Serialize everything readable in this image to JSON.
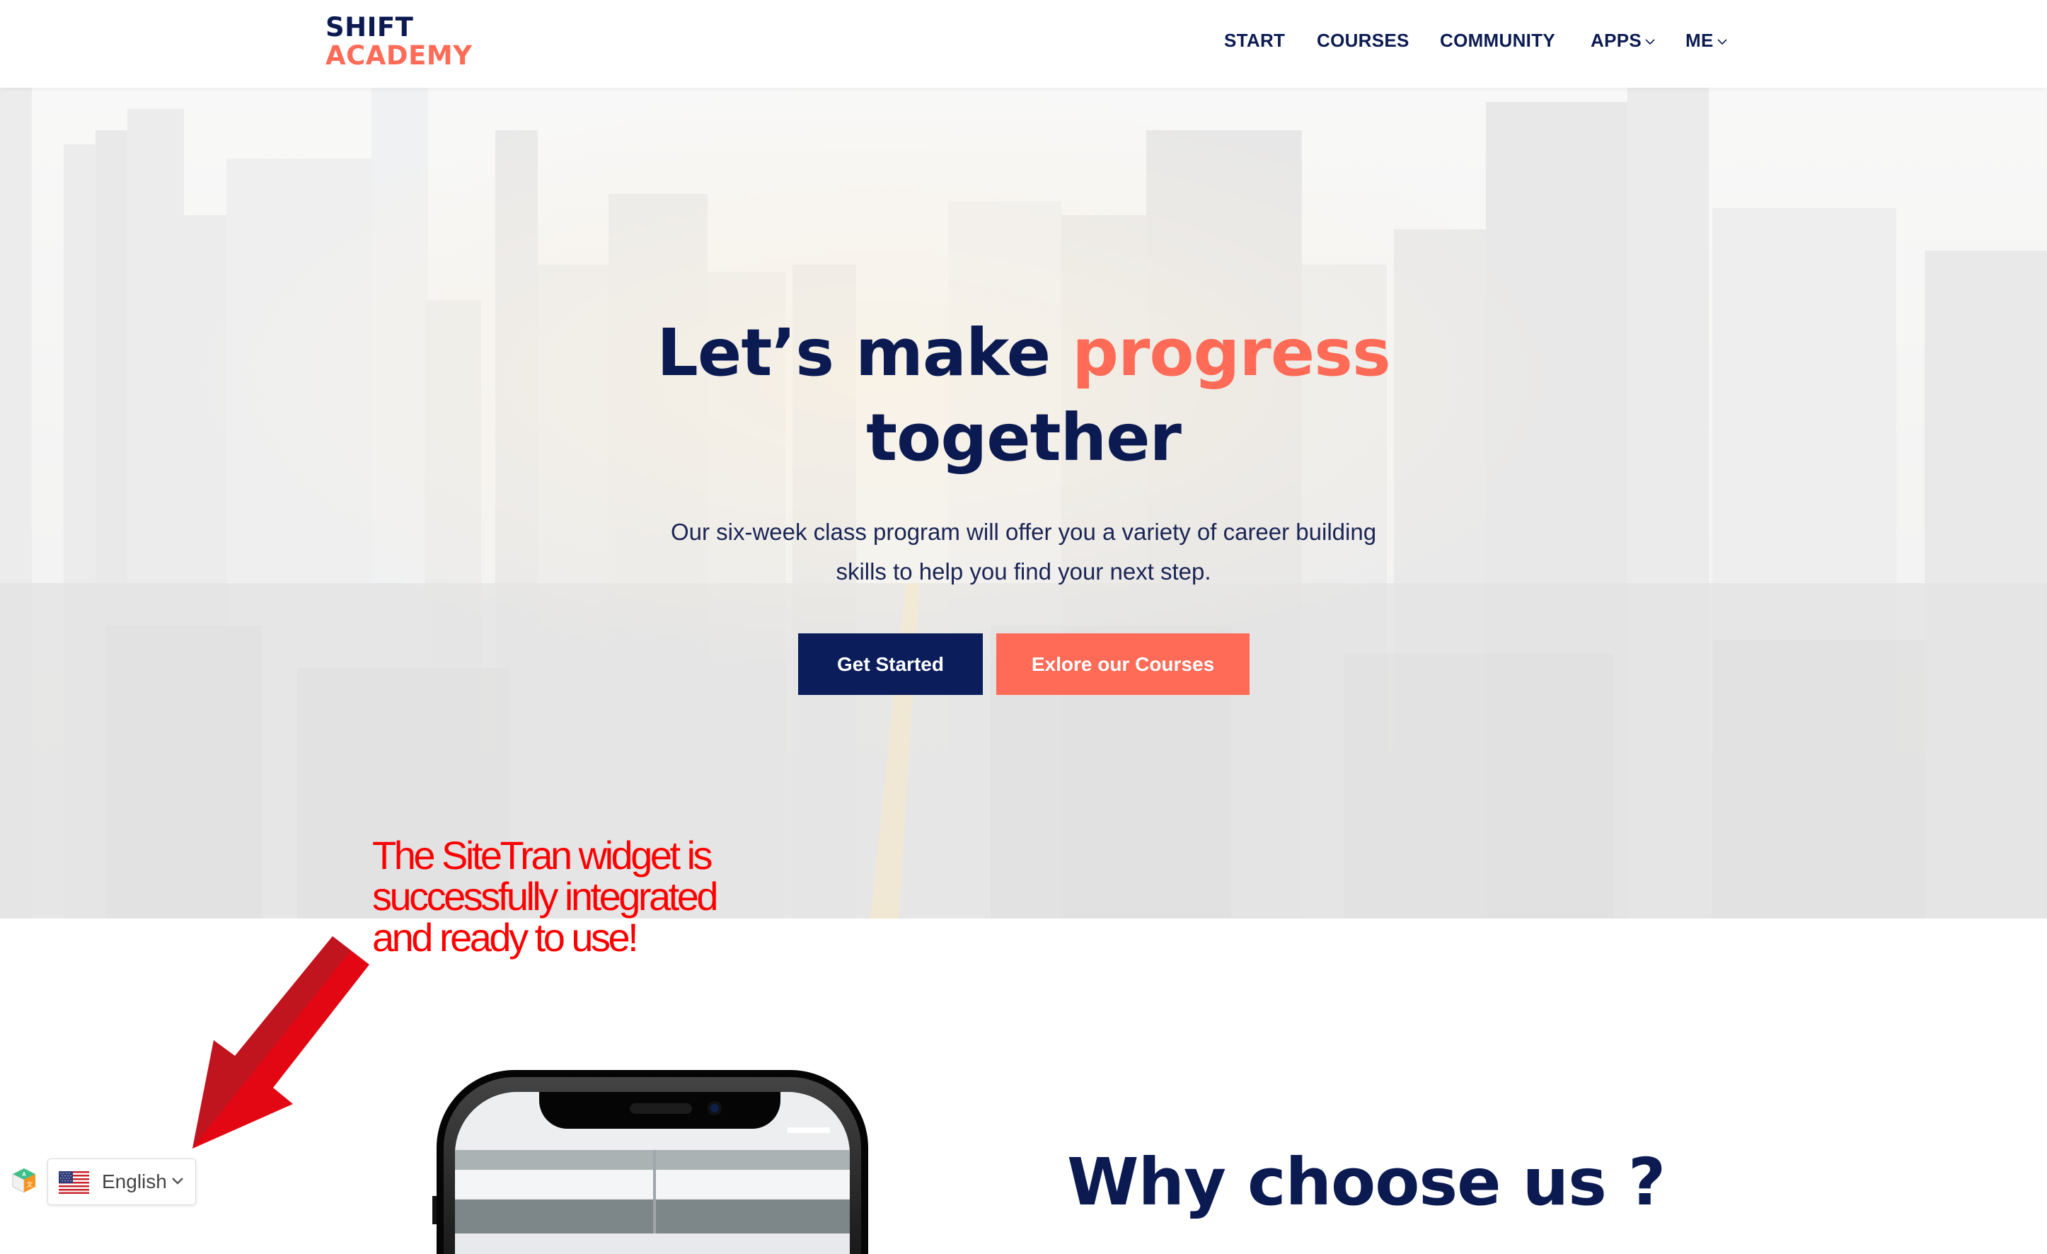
{
  "header": {
    "logo_line1": "SHIFT",
    "logo_line2": "ACADEMY",
    "nav": [
      {
        "label": "START",
        "has_dropdown": false
      },
      {
        "label": "COURSES",
        "has_dropdown": false
      },
      {
        "label": "COMMUNITY",
        "has_dropdown": false
      },
      {
        "label": "APPS",
        "has_dropdown": true
      },
      {
        "label": "ME",
        "has_dropdown": true
      }
    ]
  },
  "hero": {
    "title_part1": "Let’s make ",
    "title_accent": "progress",
    "title_line2": "together",
    "subtitle_line1": "Our six-week class program will offer you a variety of career building",
    "subtitle_line2": "skills to help you find your next step.",
    "primary_button": "Get Started",
    "secondary_button": "Exlore our Courses"
  },
  "annotation": {
    "line1": "The SiteTran widget is",
    "line2": "successfully integrated",
    "line3": "and ready to use!"
  },
  "why_section": {
    "title": "Why choose us ?"
  },
  "language_widget": {
    "icon": "sitetran-cube-icon",
    "flag": "us-flag-icon",
    "selected_language": "English"
  },
  "colors": {
    "navy": "#0b1b52",
    "coral": "#ff6b57",
    "annotation_red": "#ff0000"
  }
}
